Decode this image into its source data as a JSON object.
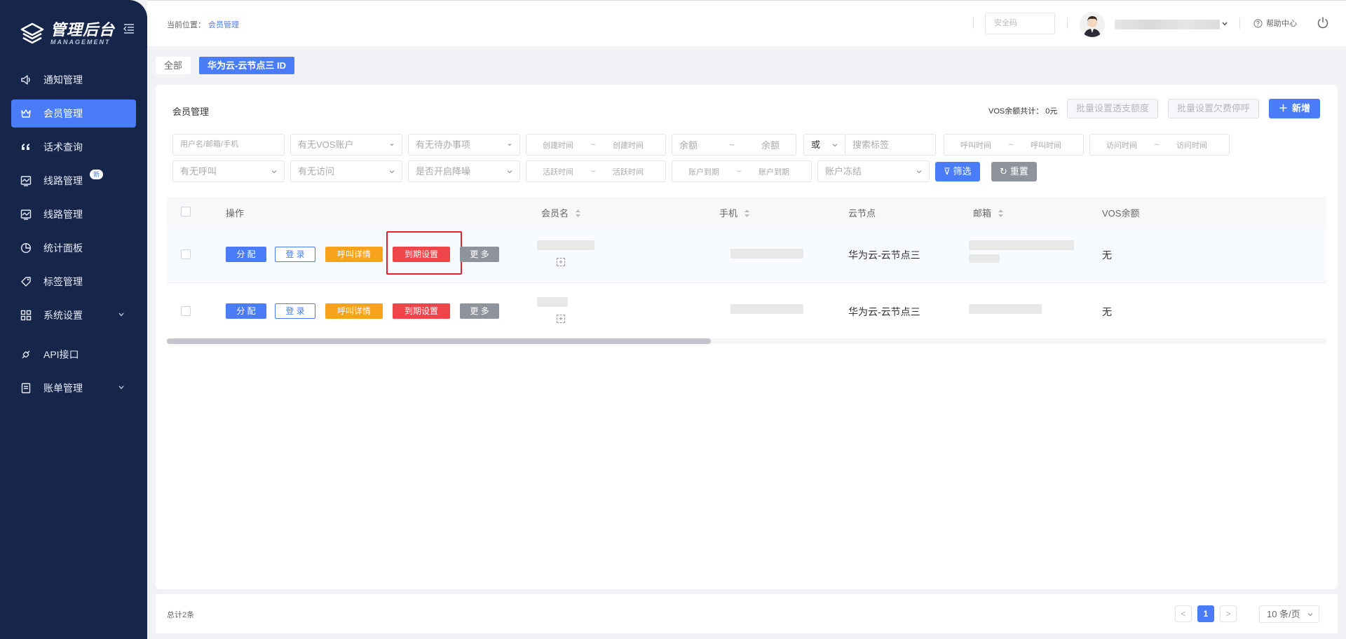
{
  "sidebar": {
    "logo_title": "管理后台",
    "logo_subtitle": "MANAGEMENT",
    "items": [
      {
        "label": "通知管理",
        "icon": "speaker-icon",
        "active": false
      },
      {
        "label": "会员管理",
        "icon": "crown-icon",
        "active": true
      },
      {
        "label": "话术查询",
        "icon": "quote-icon",
        "active": false
      },
      {
        "label": "线路管理",
        "icon": "line-chart-icon",
        "active": false,
        "badge": "新"
      },
      {
        "label": "线路管理",
        "icon": "line-chart-icon",
        "active": false
      },
      {
        "label": "统计面板",
        "icon": "pie-chart-icon",
        "active": false
      },
      {
        "label": "标签管理",
        "icon": "tag-icon",
        "active": false
      },
      {
        "label": "系统设置",
        "icon": "grid-icon",
        "active": false,
        "expandable": true
      },
      {
        "label": "API接口",
        "icon": "api-icon",
        "active": false
      },
      {
        "label": "账单管理",
        "icon": "bill-icon",
        "active": false,
        "expandable": true
      }
    ]
  },
  "header": {
    "breadcrumb_label": "当前位置：",
    "breadcrumb_current": "会员管理",
    "safe_code_placeholder": "安全码",
    "help_label": "帮助中心"
  },
  "tags": [
    {
      "label": "全部",
      "active": false
    },
    {
      "label": "华为云-云节点三  ID",
      "active": true
    }
  ],
  "main": {
    "title": "会员管理",
    "vos_total": "VOS余额共计：  0元",
    "btn_batch_overdraft": "批量设置透支额度",
    "btn_batch_suspend": "批量设置欠费停呼",
    "btn_add": "新增",
    "filters": {
      "user_placeholder": "用户名/邮箱/手机",
      "vos_account": "有无VOS账户",
      "todo": "有无待办事项",
      "create_time_start": "创建时间",
      "create_time_end": "创建时间",
      "range_sep": "~",
      "balance_start": "余额",
      "balance_end": "余额",
      "logic": "或",
      "search_tags": "搜索标签",
      "call_time_start": "呼叫时间",
      "call_time_end": "呼叫时间",
      "visit_time_start": "访问时间",
      "visit_time_end": "访问时间",
      "has_call": "有无呼叫",
      "has_visit": "有无访问",
      "noise": "是否开启降噪",
      "active_time_start": "活跃时间",
      "active_time_end": "活跃时间",
      "expire_start": "账户到期",
      "expire_end": "账户到期",
      "freeze": "账户冻结",
      "btn_filter": "筛选",
      "btn_reset": "重置"
    },
    "table": {
      "headers": {
        "ops": "操作",
        "member": "会员名",
        "phone": "手机",
        "node": "云节点",
        "email": "邮箱",
        "vos": "VOS余额"
      },
      "op_labels": {
        "assign": "分 配",
        "login": "登 录",
        "call_detail": "呼叫详情",
        "expire_setting": "到期设置",
        "more": "更 多"
      },
      "rows": [
        {
          "node": "华为云-云节点三",
          "vos": "无",
          "qr": "+"
        },
        {
          "node": "华为云-云节点三",
          "vos": "无",
          "qr": "+"
        }
      ]
    }
  },
  "footer": {
    "total": "总计2条",
    "prev": "<",
    "page": "1",
    "next": ">",
    "page_size": "10 条/页"
  },
  "colors": {
    "sidebar_bg": "#16264a",
    "primary": "#4a7cf7",
    "orange": "#f7a21b",
    "red": "#f0444b",
    "gray_button": "#8f949c",
    "highlight_box": "#e6202a"
  }
}
